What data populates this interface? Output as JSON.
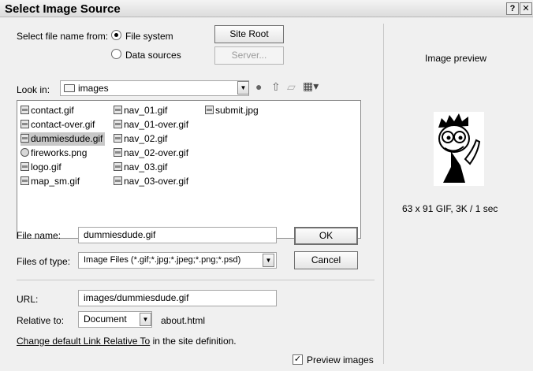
{
  "window": {
    "title": "Select Image Source"
  },
  "source": {
    "label": "Select file name from:",
    "option_file_system": "File system",
    "option_data_sources": "Data sources",
    "selected": "File system"
  },
  "buttons": {
    "site_root": "Site Root",
    "server": "Server...",
    "ok": "OK",
    "cancel": "Cancel"
  },
  "look_in": {
    "label": "Look in:",
    "value": "images"
  },
  "files": {
    "col1": [
      {
        "name": "contact.gif",
        "icon": "gif-file-icon"
      },
      {
        "name": "contact-over.gif",
        "icon": "gif-file-icon"
      },
      {
        "name": "dummiesdude.gif",
        "icon": "gif-file-icon",
        "selected": true
      },
      {
        "name": "fireworks.png",
        "icon": "fireworks-png-icon"
      },
      {
        "name": "logo.gif",
        "icon": "gif-file-icon"
      },
      {
        "name": "map_sm.gif",
        "icon": "gif-file-icon"
      }
    ],
    "col2": [
      {
        "name": "nav_01.gif",
        "icon": "gif-file-icon"
      },
      {
        "name": "nav_01-over.gif",
        "icon": "gif-file-icon"
      },
      {
        "name": "nav_02.gif",
        "icon": "gif-file-icon"
      },
      {
        "name": "nav_02-over.gif",
        "icon": "gif-file-icon"
      },
      {
        "name": "nav_03.gif",
        "icon": "gif-file-icon"
      },
      {
        "name": "nav_03-over.gif",
        "icon": "gif-file-icon"
      }
    ],
    "col3": [
      {
        "name": "submit.jpg",
        "icon": "jpg-file-icon"
      }
    ]
  },
  "file_name": {
    "label": "File name:",
    "value": "dummiesdude.gif"
  },
  "files_of_type": {
    "label": "Files of type:",
    "value": "Image Files (*.gif;*.jpg;*.jpeg;*.png;*.psd)"
  },
  "url": {
    "label": "URL:",
    "value": "images/dummiesdude.gif"
  },
  "relative_to": {
    "label": "Relative to:",
    "value": "Document",
    "file": "about.html"
  },
  "link_note": {
    "link_text": "Change default Link Relative To",
    "suffix": " in the site definition."
  },
  "preview": {
    "heading": "Image preview",
    "info": "63 x 91 GIF, 3K / 1 sec",
    "checkbox_label": "Preview images",
    "checked": true
  }
}
